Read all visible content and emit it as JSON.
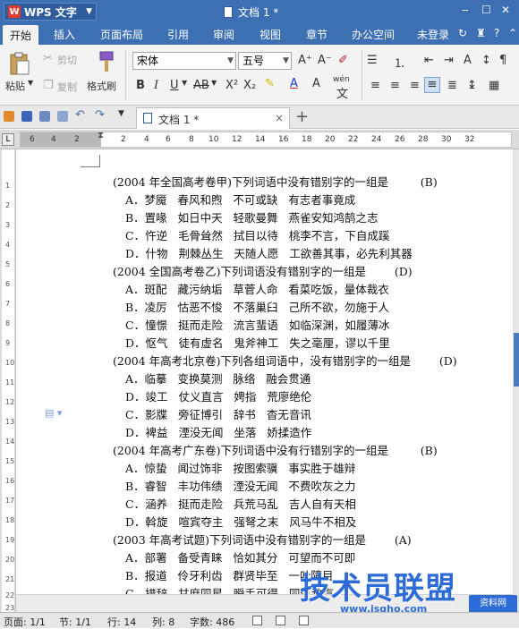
{
  "titlebar": {
    "app_name": "WPS 文字",
    "doc_title": "文档 1 *",
    "controls": [
      "‒",
      "☐",
      "✕"
    ]
  },
  "menu": {
    "tabs": [
      "开始",
      "插入",
      "页面布局",
      "引用",
      "审阅",
      "视图",
      "章节",
      "办公空间"
    ],
    "active": "开始",
    "login": "未登录"
  },
  "ribbon": {
    "paste": "粘贴",
    "cut": "剪切",
    "copy": "复制",
    "format_painter": "格式刷",
    "font_name": "宋体",
    "font_size": "五号",
    "wen": "wén"
  },
  "quickbar": {
    "doc_tab": "文档 1 *",
    "close": "×",
    "new_tab": "+"
  },
  "ruler": {
    "marks": [
      "6",
      "4",
      "2",
      "2",
      "4",
      "6",
      "8",
      "10",
      "12",
      "14",
      "16",
      "18",
      "20",
      "22",
      "24",
      "26",
      "28",
      "30",
      "32"
    ],
    "vmarks": [
      "1",
      "2",
      "3",
      "4",
      "5",
      "6",
      "7",
      "8",
      "9",
      "10",
      "11",
      "12",
      "13",
      "14",
      "15",
      "16",
      "17",
      "18",
      "19",
      "20",
      "21",
      "22",
      "23"
    ],
    "corner": "L"
  },
  "document": {
    "lines": [
      "(2004 年全国高考卷甲)下列词语中没有错别字的一组是         (B)",
      "A．梦魇   春风和煦   不可或缺   有志者事竟成",
      "B．置喙   如日中天   轻歌曼舞   燕雀安知鸿鹄之志",
      "C．忤逆   毛骨耸然   拭目以待   桃李不言，下自成蹊",
      "D．什物   荆棘丛生   天随人愿   工欲善其事，必先利其器",
      "(2004 全国高考卷乙)下列词语没有错别字的一组是        (D)",
      "A．斑配   藏污纳垢   草菅人命   看菜吃饭，量体裁衣",
      "B．凌厉   怙恶不悛   不落巢臼   己所不欲，勿施于人",
      "C．憧憬   挺而走险   流言蜚语   如临深渊，如履薄冰",
      "D．怄气   徒有虚名   鬼斧神工   失之毫厘，谬以千里",
      "(2004 年高考北京卷)下列各组词语中，没有错别字的一组是        (D)",
      "A．临摹   变换莫测   脉络   融会贯通",
      "D．竣工   仗义直言   娉指   荒廖绝伦",
      "C．影牒   旁征博引   辞书   杳无音讯",
      "D．裨益   湮没无闻   坐落   娇揉造作",
      "(2004 年高考广东卷)下列词语中没有行错别字的一组是         (B)",
      "A．惊蛰   闻过饰非   按图索骥   事实胜于雄辩",
      "B．睿智   丰功伟绩   湮没无闻   不费吹灰之力",
      "C．涵养   挺而走险   兵荒马乱   吉人自有天相",
      "D．斡旋   喧宾夺主   强弩之末   风马牛不相及",
      "(2003 年高考试题)下列词语中没有错别字的一组是        (A)",
      "A．部署   备受青睐   恰如其分   可望而不可即",
      "B．报道   伶牙利齿   群贤毕至   一叶障目",
      "C．措辞   甘庶同星   瞬手可得   同仇敌忾"
    ]
  },
  "status": {
    "page": "页面: 1/1",
    "section": "节: 1/1",
    "row": "行: 14",
    "col": "列: 8",
    "words": "字数: 486"
  },
  "watermark": {
    "main": "技术员联盟",
    "url": "www.jsgho.com",
    "badge": "资料网"
  },
  "colors": {
    "title_blue": "#3d6fb3",
    "accent": "#4a7bc0"
  }
}
